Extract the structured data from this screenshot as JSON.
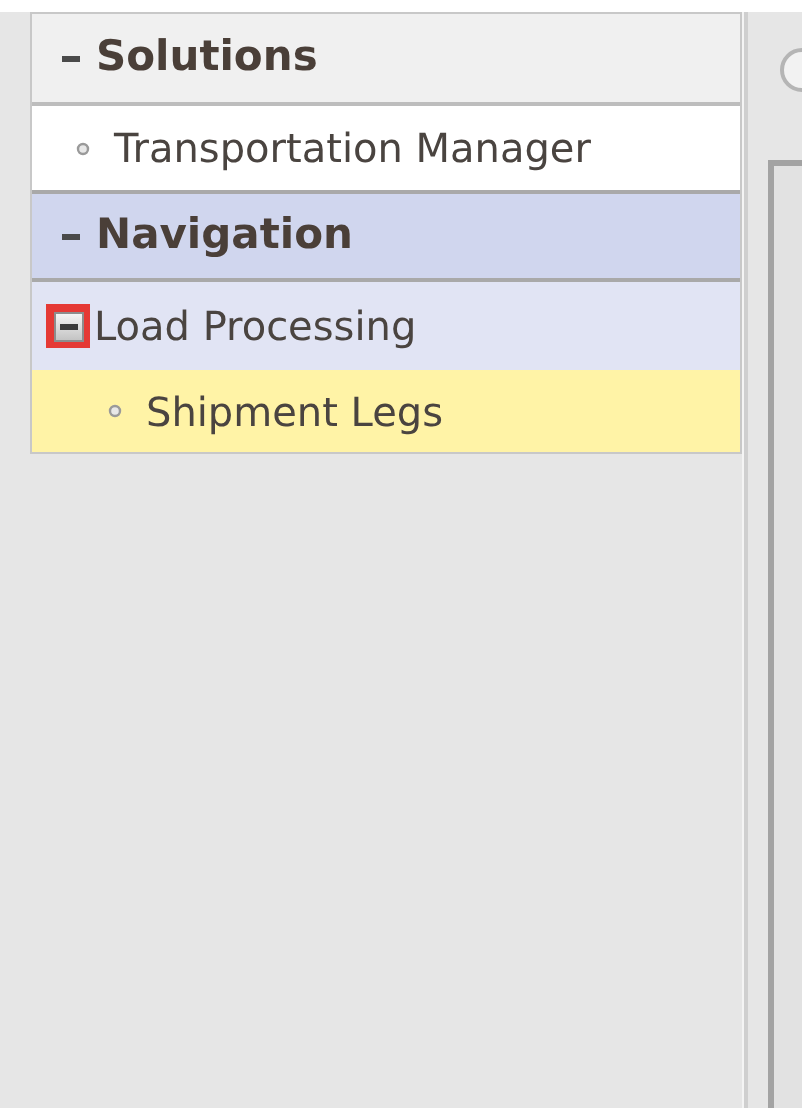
{
  "sidebar": {
    "sections": [
      {
        "kind": "list",
        "title": "Solutions",
        "expanded": true,
        "items": [
          {
            "label": "Transportation Manager",
            "selected": false
          }
        ]
      },
      {
        "kind": "tree",
        "title": "Navigation",
        "expanded": true,
        "items": [
          {
            "label": "Load Processing",
            "expanded": true,
            "focused": true,
            "children": [
              {
                "label": "Shipment Legs",
                "selected": true
              }
            ]
          }
        ]
      }
    ]
  }
}
